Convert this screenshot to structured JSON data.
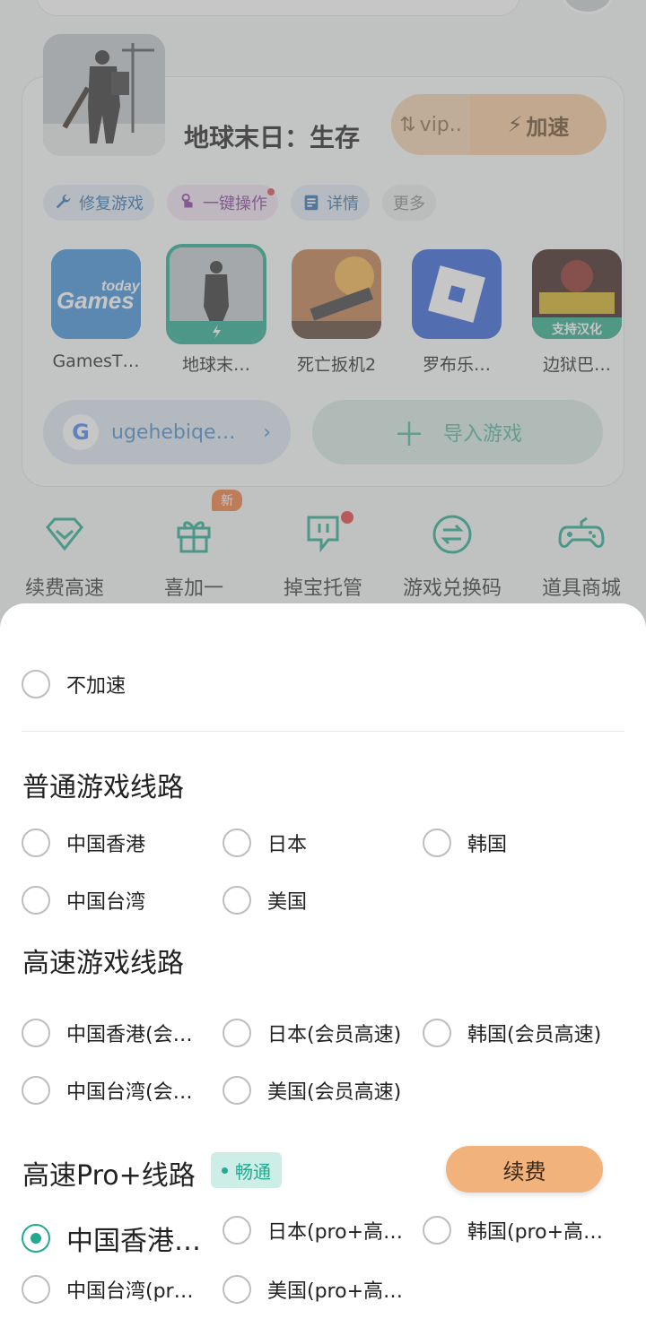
{
  "game": {
    "title": "地球末日：生存",
    "speed_left_label": "vip..",
    "speed_right_label": "加速"
  },
  "chips": [
    {
      "label": "修复游戏",
      "icon": "wrench-icon"
    },
    {
      "label": "一键操作",
      "icon": "tap-hand-icon"
    },
    {
      "label": "详情",
      "icon": "document-icon"
    },
    {
      "label": "更多"
    }
  ],
  "games": [
    {
      "name": "GamesT…"
    },
    {
      "name": "地球末…"
    },
    {
      "name": "死亡扳机2"
    },
    {
      "name": "罗布乐…"
    },
    {
      "name": "边狱巴…",
      "badge": "支持汉化"
    }
  ],
  "account": {
    "logo": "G",
    "label": "ugehebiqe…",
    "arrow": "›"
  },
  "import": {
    "label": "导入游戏"
  },
  "quick": [
    {
      "label": "续费高速",
      "icon": "diamond-icon"
    },
    {
      "label": "喜加一",
      "icon": "gift-icon",
      "badge": "新"
    },
    {
      "label": "掉宝托管",
      "icon": "twitch-icon"
    },
    {
      "label": "游戏兑换码",
      "icon": "exchange-icon"
    },
    {
      "label": "道具商城",
      "icon": "gamepad-icon"
    }
  ],
  "sheet": {
    "no_accel": "不加速",
    "normal_title": "普通游戏线路",
    "normal_opts": [
      "中国香港",
      "日本",
      "韩国",
      "中国台湾",
      "美国"
    ],
    "fast_title": "高速游戏线路",
    "fast_opts": [
      "中国香港(会…",
      "日本(会员高速)",
      "韩国(会员高速)",
      "中国台湾(会…",
      "美国(会员高速)"
    ],
    "pro_title": "高速Pro+线路",
    "pro_tag": "畅通",
    "renew_label": "续费",
    "pro_opts": [
      "中国香港…",
      "日本(pro+高…",
      "韩国(pro+高…",
      "中国台湾(pr…",
      "美国(pro+高…"
    ],
    "selected_line": "中国香港…"
  }
}
